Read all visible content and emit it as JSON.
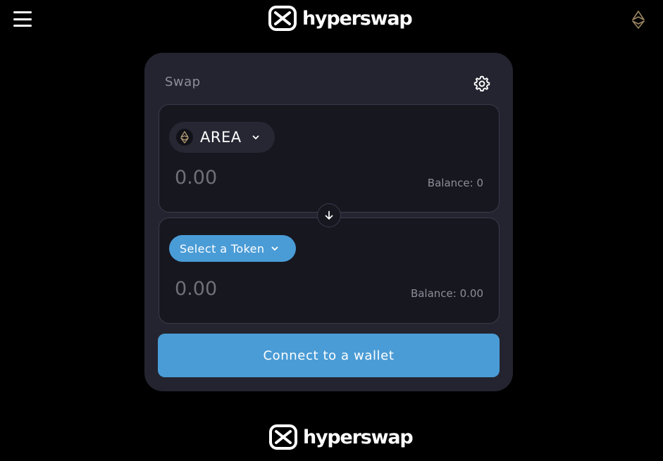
{
  "header": {
    "brand_name": "hyperswap",
    "menu_icon": "hamburger-menu-icon",
    "network_icon": "ethereum-icon"
  },
  "swap": {
    "title": "Swap",
    "settings_icon": "gear-icon",
    "from": {
      "token_symbol": "AREA",
      "token_icon": "ethereum-icon",
      "amount_placeholder": "0.00",
      "balance": "Balance: 0"
    },
    "flip_icon": "arrow-down-icon",
    "to": {
      "select_label": "Select a Token",
      "amount_placeholder": "0.00",
      "balance": "Balance: 0.00"
    },
    "connect_label": "Connect to a wallet"
  },
  "footer": {
    "brand_name": "hyperswap"
  },
  "colors": {
    "background": "#000000",
    "card": "#23242f",
    "panel": "#171720",
    "accent": "#4a9cd6",
    "muted_text": "#8d8e98"
  }
}
